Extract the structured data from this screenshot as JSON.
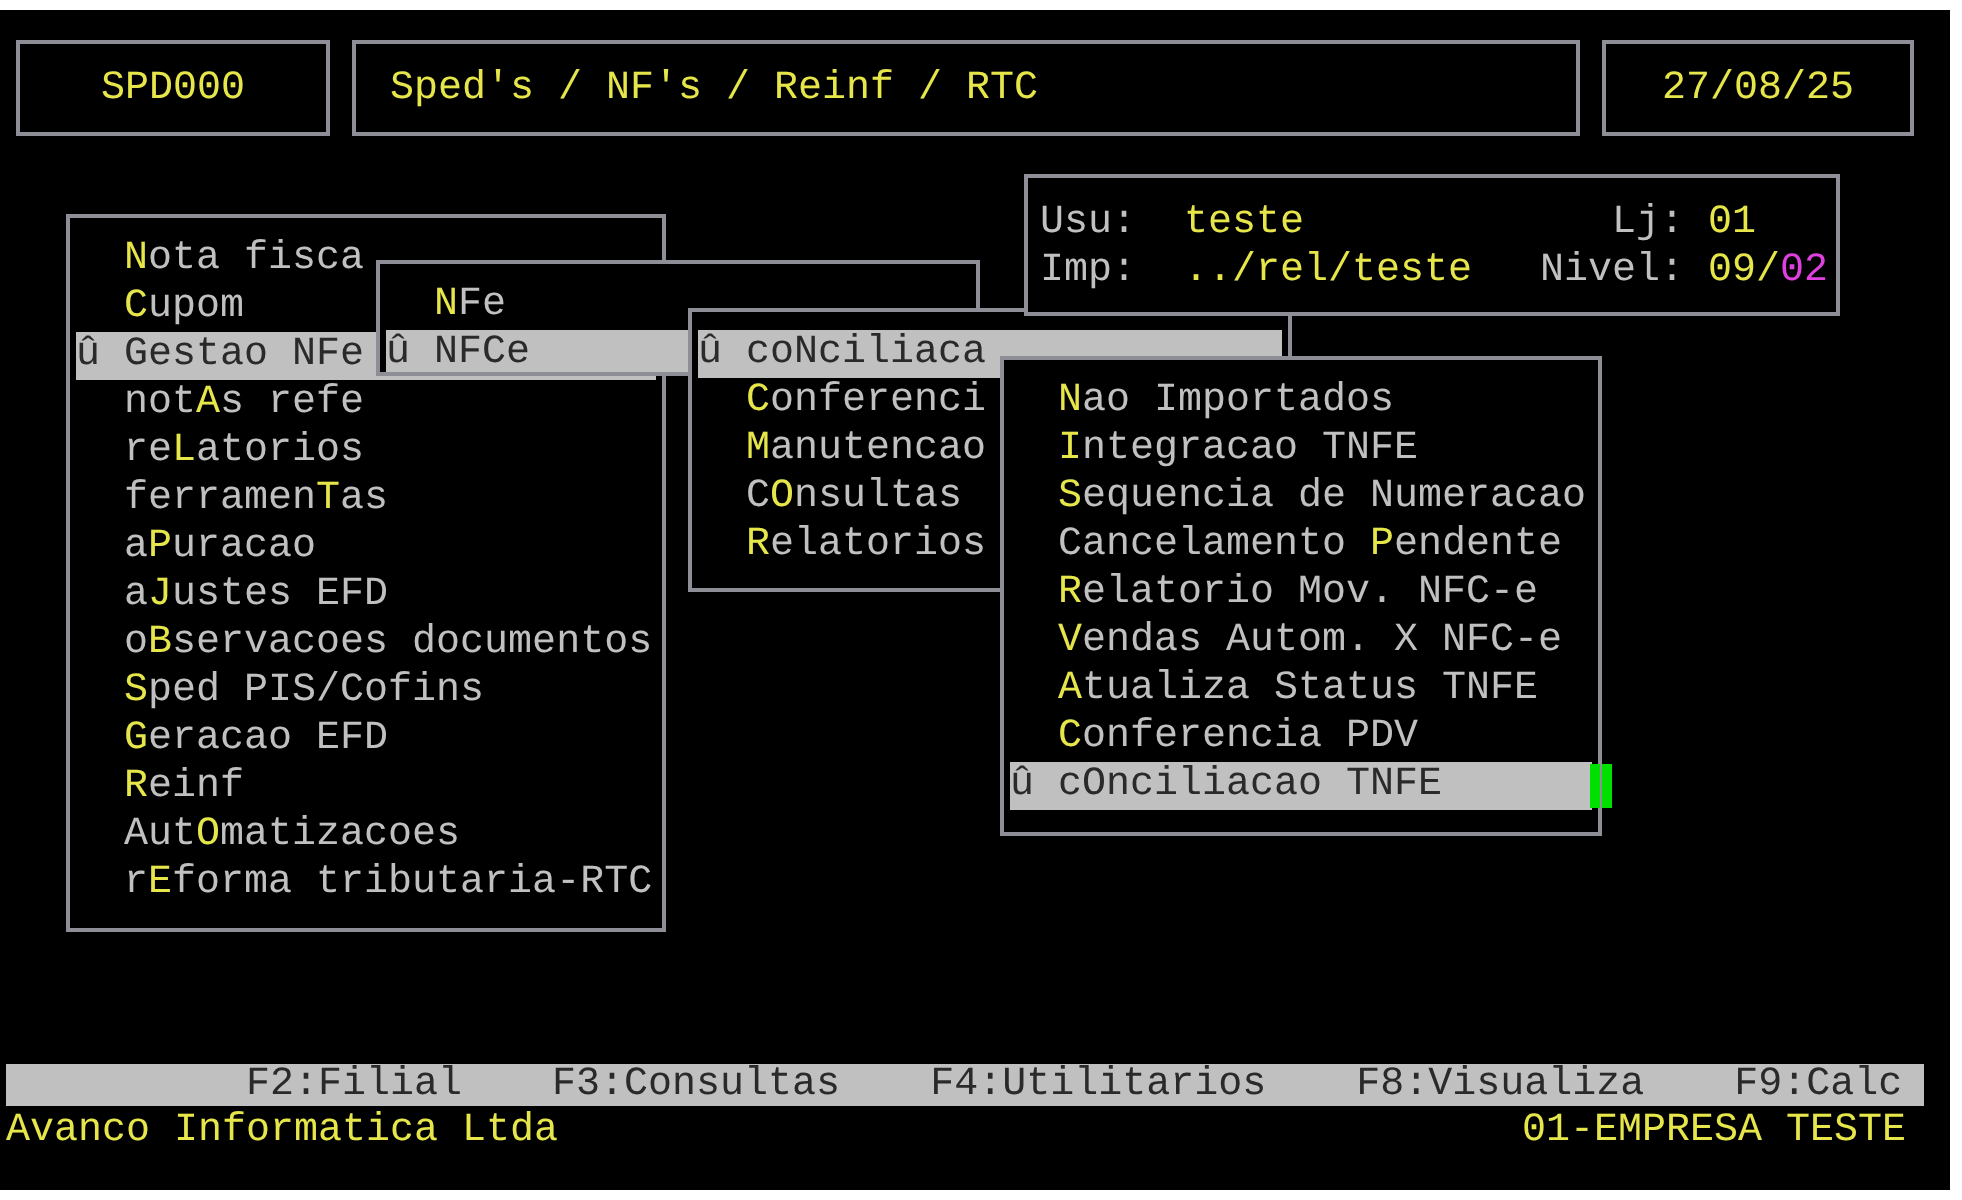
{
  "header": {
    "program": "SPD000",
    "title": "Sped's / NF's / Reinf / RTC",
    "date": "27/08/25"
  },
  "menus": [
    {
      "items": [
        {
          "label": "**N**ota fisca",
          "selected": false
        },
        {
          "label": "**C**upom",
          "selected": false
        },
        {
          "label": "û Gestao NFe",
          "selected": true
        },
        {
          "label": "not**A**s refe",
          "selected": false
        },
        {
          "label": "re**L**atorios",
          "selected": false
        },
        {
          "label": "ferramen**T**as",
          "selected": false
        },
        {
          "label": "a**P**uracao",
          "selected": false
        },
        {
          "label": "a**J**ustes EFD",
          "selected": false
        },
        {
          "label": "o**B**servacoes documentos",
          "selected": false
        },
        {
          "label": "**S**ped PIS/Cofins",
          "selected": false
        },
        {
          "label": "**G**eracao EFD",
          "selected": false
        },
        {
          "label": "**R**einf",
          "selected": false
        },
        {
          "label": "Aut**O**matizacoes",
          "selected": false
        },
        {
          "label": "r**E**forma tributaria-RTC",
          "selected": false
        }
      ]
    },
    {
      "items": [
        {
          "label": "**N**Fe",
          "selected": false
        },
        {
          "label": "û NFCe",
          "selected": true
        }
      ]
    },
    {
      "items": [
        {
          "label": "û coNciliaca",
          "selected": true
        },
        {
          "label": "**C**onferenci",
          "selected": false
        },
        {
          "label": "**M**anutencao",
          "selected": false
        },
        {
          "label": "C**O**nsultas",
          "selected": false
        },
        {
          "label": "**R**elatorios",
          "selected": false
        }
      ]
    },
    {
      "items": [
        {
          "label": "**N**ao Importados",
          "selected": false
        },
        {
          "label": "**I**ntegracao TNFE",
          "selected": false
        },
        {
          "label": "**S**equencia de Numeracao",
          "selected": false
        },
        {
          "label": "Cancelamento **P**endente",
          "selected": false
        },
        {
          "label": "**R**elatorio Mov. NFC-e",
          "selected": false
        },
        {
          "label": "**V**endas Autom. X NFC-e",
          "selected": false
        },
        {
          "label": "**A**tualiza Status TNFE",
          "selected": false
        },
        {
          "label": "**C**onferencia PDV",
          "selected": false
        },
        {
          "label": "û cOnciliacao TNFE",
          "selected": true
        }
      ]
    }
  ],
  "info": {
    "user_label": "Usu:",
    "user": "teste",
    "store_label": "Lj:",
    "store": "01",
    "printer_label": "Imp:",
    "printer": "../rel/teste",
    "nivel_label": "Nivel:",
    "nivel": "09/",
    "nivel_sub": "02"
  },
  "function_keys": [
    "F2:Filial",
    "F3:Consultas",
    "F4:Utilitarios",
    "F8:Visualiza",
    "F9:Calc"
  ],
  "status": {
    "company": "Avanco Informatica Ltda",
    "branch": "01-EMPRESA TESTE"
  }
}
